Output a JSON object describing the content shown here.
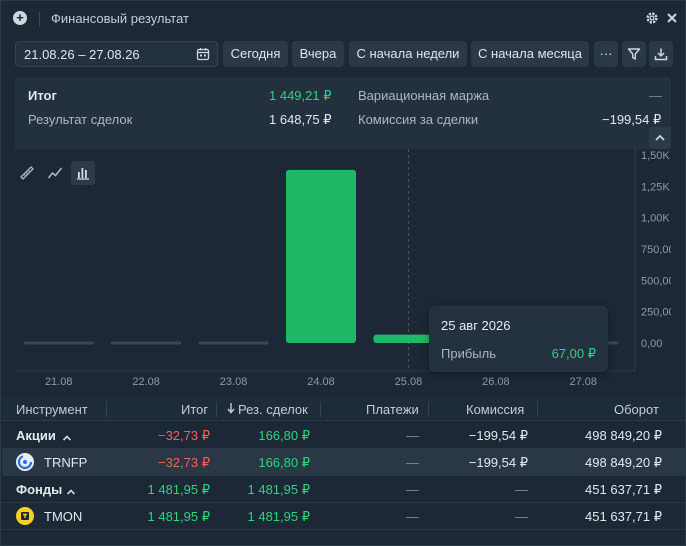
{
  "window": {
    "title": "Финансовый результат"
  },
  "toolbar": {
    "date_range": "21.08.26 – 27.08.26",
    "btn_today": "Сегодня",
    "btn_yesterday": "Вчера",
    "btn_week": "С начала недели",
    "btn_month": "С начала месяца",
    "btn_more": "···"
  },
  "summary": {
    "total_label": "Итог",
    "total_value": "1 449,21 ₽",
    "trades_label": "Результат сделок",
    "trades_value": "1 648,75 ₽",
    "margin_label": "Вариационная маржа",
    "margin_value": "—",
    "fee_label": "Комиссия за сделки",
    "fee_value": "−199,54 ₽"
  },
  "chart_data": {
    "type": "bar",
    "categories": [
      "21.08",
      "22.08",
      "23.08",
      "24.08",
      "25.08",
      "26.08",
      "27.08"
    ],
    "values": [
      0,
      0,
      0,
      1381,
      67,
      0,
      0
    ],
    "y_ticks": [
      "1,50K",
      "1,25K",
      "1,00K",
      "750,00",
      "500,00",
      "250,00",
      "0,00"
    ],
    "ylim": [
      0,
      1500
    ],
    "grid": false,
    "colors": {
      "positive": "#1fb866",
      "zero": "#3a4855"
    },
    "hover_category": "25.08"
  },
  "tooltip": {
    "date": "25 авг 2026",
    "label": "Прибыль",
    "value": "67,00 ₽"
  },
  "table": {
    "headers": {
      "instrument": "Инструмент",
      "total": "Итог",
      "trades": "Рез. сделок",
      "payments": "Платежи",
      "fee": "Комиссия",
      "turnover": "Оборот"
    },
    "rows": [
      {
        "name": "Акции",
        "total": "−32,73 ₽",
        "trades": "166,80 ₽",
        "payments": "—",
        "fee": "−199,54 ₽",
        "turnover": "498 849,20 ₽"
      },
      {
        "name": "TRNFP",
        "total": "−32,73 ₽",
        "trades": "166,80 ₽",
        "payments": "—",
        "fee": "−199,54 ₽",
        "turnover": "498 849,20 ₽"
      },
      {
        "name": "Фонды",
        "total": "1 481,95 ₽",
        "trades": "1 481,95 ₽",
        "payments": "—",
        "fee": "—",
        "turnover": "451 637,71 ₽"
      },
      {
        "name": "TMON",
        "total": "1 481,95 ₽",
        "trades": "1 481,95 ₽",
        "payments": "—",
        "fee": "—",
        "turnover": "451 637,71 ₽"
      }
    ]
  }
}
